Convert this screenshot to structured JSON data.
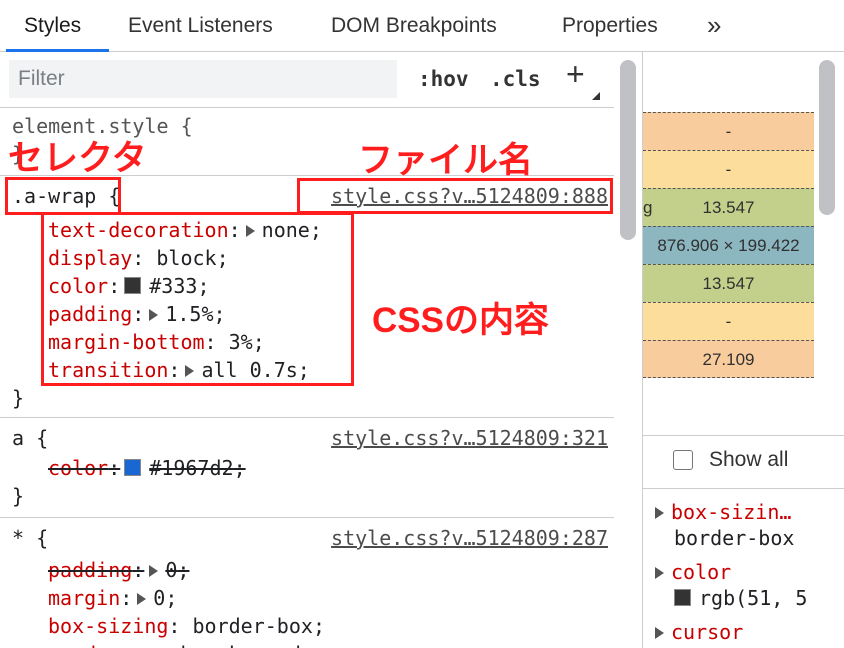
{
  "tabs": [
    {
      "label": "Styles",
      "active": true
    },
    {
      "label": "Event Listeners",
      "active": false
    },
    {
      "label": "DOM Breakpoints",
      "active": false
    },
    {
      "label": "Properties",
      "active": false
    }
  ],
  "tabs_overflow": "»",
  "filter": {
    "placeholder": "Filter",
    "hov": ":hov",
    "cls": ".cls",
    "add": "+"
  },
  "element_style": {
    "open": "element.style {",
    "close": "}"
  },
  "rules": [
    {
      "selector": ".a-wrap",
      "brace": "{",
      "source": "style.css?v…5124809:888",
      "declarations": [
        {
          "name": "text-decoration",
          "value": "none",
          "expandable": true
        },
        {
          "name": "display",
          "value": "block"
        },
        {
          "name": "color",
          "value": "#333",
          "swatch": "#333333"
        },
        {
          "name": "padding",
          "value": "1.5%",
          "expandable": true
        },
        {
          "name": "margin-bottom",
          "value": "3%"
        },
        {
          "name": "transition",
          "value": "all 0.7s",
          "expandable": true
        }
      ],
      "close": "}"
    },
    {
      "selector": "a",
      "brace": "{",
      "source": "style.css?v…5124809:321",
      "declarations": [
        {
          "name": "color",
          "value": "#1967d2",
          "swatch": "#1967d2",
          "overridden": true
        }
      ],
      "close": "}"
    },
    {
      "selector": "*",
      "brace": "{",
      "source": "style.css?v…5124809:287",
      "declarations": [
        {
          "name": "padding",
          "value": "0",
          "expandable": true,
          "overridden": true
        },
        {
          "name": "margin",
          "value": "0",
          "expandable": true
        },
        {
          "name": "box-sizing",
          "value": "border-box"
        },
        {
          "name": "word-wrap",
          "value": "break-word"
        }
      ]
    }
  ],
  "annotations": {
    "selector": "セレクタ",
    "filename": "ファイル名",
    "css_content": "CSSの内容"
  },
  "box_model": [
    {
      "value": "-",
      "color": "#f9cc9d"
    },
    {
      "value": "-",
      "color": "#fddd9b"
    },
    {
      "value": "13.547",
      "color": "#c3d08b",
      "prefix": "g"
    },
    {
      "value": "876.906 × 199.422",
      "color": "#8cb6c0"
    },
    {
      "value": "13.547",
      "color": "#c3d08b"
    },
    {
      "value": "-",
      "color": "#fddd9b"
    },
    {
      "value": "27.109",
      "color": "#f9cc9d"
    }
  ],
  "show_all": "Show all",
  "computed": [
    {
      "name": "box-sizin…",
      "value": "border-box"
    },
    {
      "name": "color",
      "value": "rgb(51, 5",
      "swatch": "#333333"
    },
    {
      "name": "cursor",
      "value": ""
    }
  ],
  "colors": {
    "accent": "#1a73e8",
    "annotation": "#ff1d1d",
    "property": "#c80000"
  }
}
